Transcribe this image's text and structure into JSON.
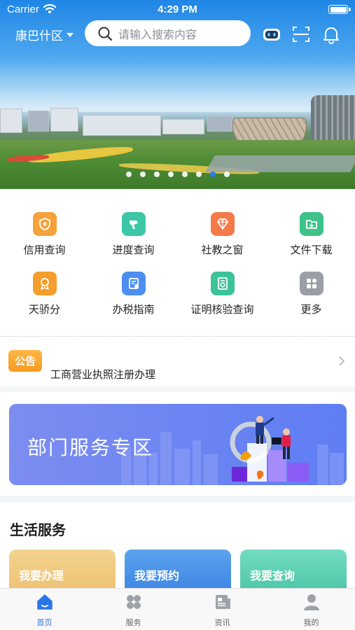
{
  "status_bar": {
    "carrier": "Carrier",
    "time": "4:29 PM"
  },
  "header": {
    "district": "康巴什区",
    "search_placeholder": "请输入搜索内容"
  },
  "banner": {
    "dot_count": 8,
    "active_index": 6
  },
  "quick_grid": [
    {
      "label": "信用查询",
      "icon": "credit-query-icon",
      "color": "#f5a23a"
    },
    {
      "label": "进度查询",
      "icon": "progress-query-icon",
      "color": "#3cc7a6"
    },
    {
      "label": "社教之窗",
      "icon": "diamond-icon",
      "color": "#f47a4a"
    },
    {
      "label": "文件下载",
      "icon": "file-download-icon",
      "color": "#3ec28a"
    },
    {
      "label": "天骄分",
      "icon": "medal-icon",
      "color": "#f59e2b"
    },
    {
      "label": "办税指南",
      "icon": "tax-guide-icon",
      "color": "#4d8ff0"
    },
    {
      "label": "证明核验查询",
      "icon": "certificate-check-icon",
      "color": "#3cc39a"
    },
    {
      "label": "更多",
      "icon": "more-icon",
      "color": "#9a9ea5"
    }
  ],
  "notice": {
    "tag": "公告",
    "text": "工商营业执照注册办理"
  },
  "dept_banner": {
    "title": "部门服务专区"
  },
  "life_services": {
    "heading": "生活服务",
    "cards": [
      {
        "label": "我要办理",
        "color": "#f0c77e"
      },
      {
        "label": "我要预约",
        "color": "#4f98ea"
      },
      {
        "label": "我要查询",
        "color": "#5fd0b4"
      }
    ]
  },
  "tabbar": [
    {
      "label": "首页",
      "icon": "home-icon",
      "active": true
    },
    {
      "label": "服务",
      "icon": "services-icon",
      "active": false
    },
    {
      "label": "资讯",
      "icon": "news-icon",
      "active": false
    },
    {
      "label": "我的",
      "icon": "profile-icon",
      "active": false
    }
  ]
}
